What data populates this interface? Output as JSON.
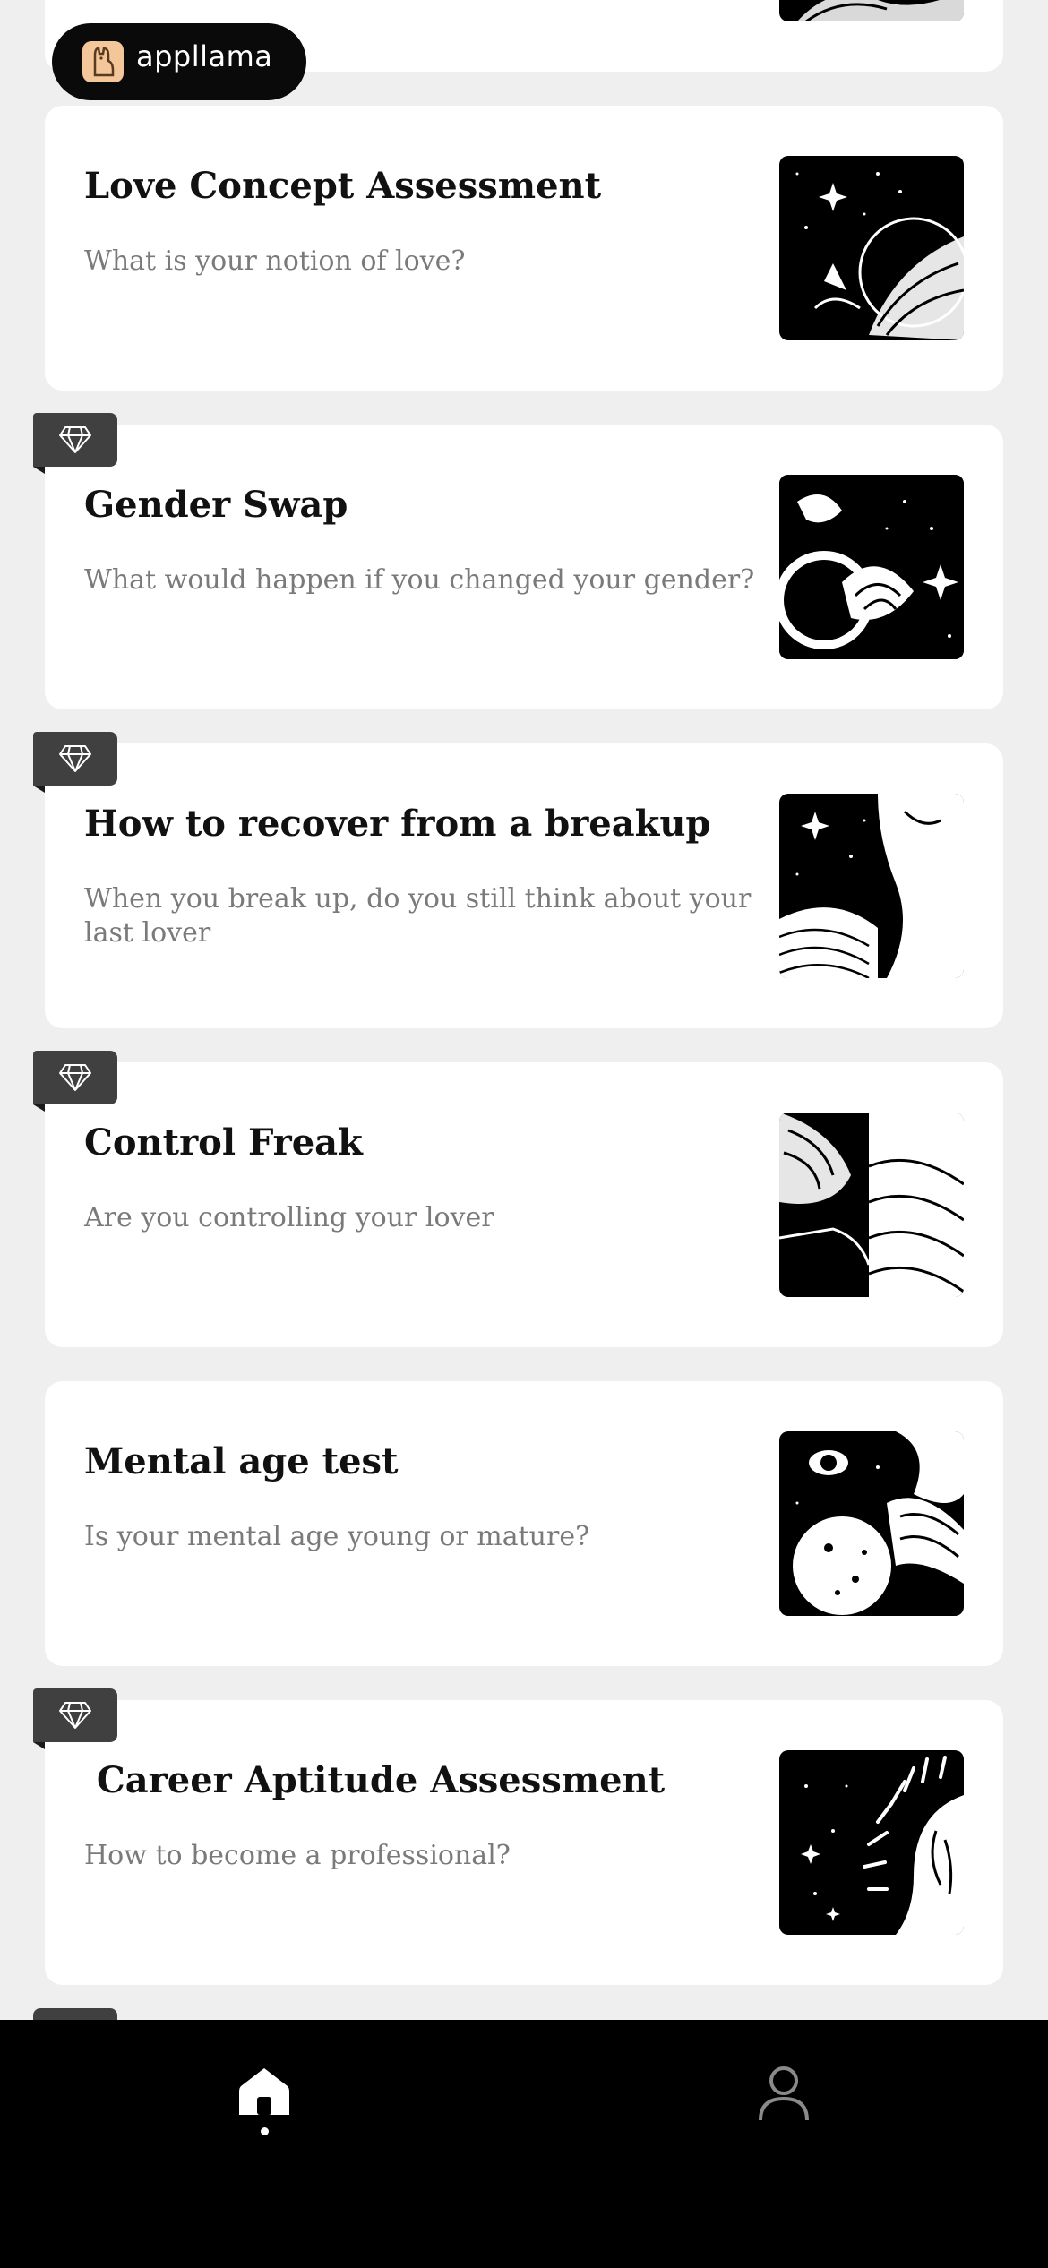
{
  "brand": {
    "name": "appllama",
    "logo_icon": "llama-icon"
  },
  "cards": [
    {
      "title": "Love Concept Assessment",
      "subtitle": "What is your notion of love?",
      "premium": false,
      "image": "moon-flower-illustration"
    },
    {
      "title": "Gender Swap",
      "subtitle": "What would happen if you changed your gender?",
      "premium": true,
      "image": "flowers-stars-illustration"
    },
    {
      "title": "How to recover from a breakup",
      "subtitle": "When you break up, do you still think about your last lover",
      "premium": true,
      "image": "embracing-figure-illustration"
    },
    {
      "title": "Control Freak",
      "subtitle": "Are you controlling your lover",
      "premium": true,
      "image": "hands-hair-illustration"
    },
    {
      "title": "Mental age test",
      "subtitle": "Is your mental age young or mature?",
      "premium": false,
      "image": "eye-moon-illustration"
    },
    {
      "title": " Career Aptitude Assessment",
      "subtitle": "How to become a professional?",
      "premium": true,
      "image": "sun-rays-face-illustration"
    }
  ],
  "tab_bar": {
    "tabs": [
      {
        "name": "home",
        "icon": "home-icon",
        "active": true
      },
      {
        "name": "profile",
        "icon": "person-icon",
        "active": false
      }
    ]
  },
  "colors": {
    "card_bg": "#ffffff",
    "page_bg": "#efefef",
    "badge_bg": "#404040",
    "tab_bar_bg": "#000000",
    "subtitle": "#7a7a7a"
  }
}
